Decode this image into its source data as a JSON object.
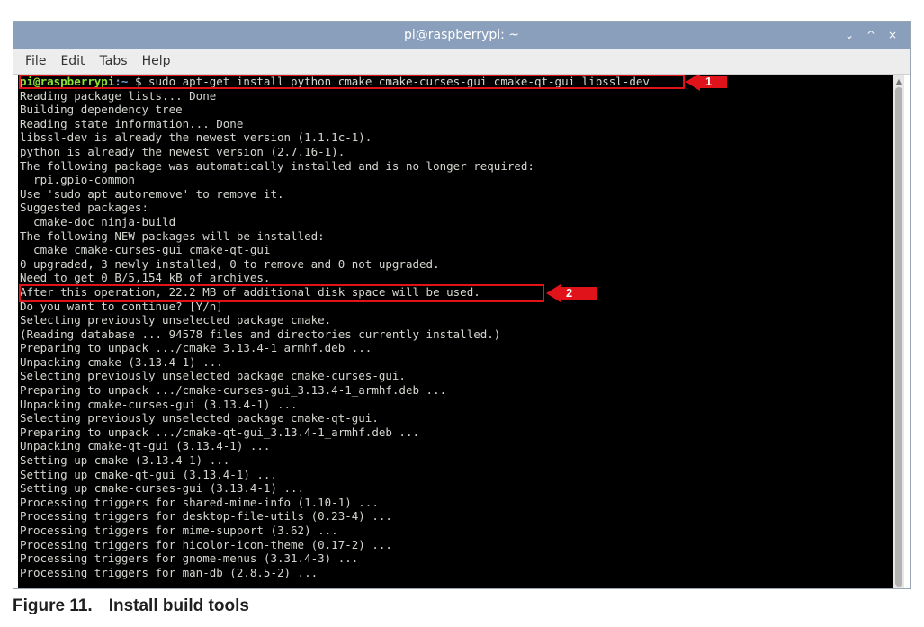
{
  "window": {
    "title": "pi@raspberrypi: ~",
    "controls": [
      "⌄",
      "^",
      "×"
    ]
  },
  "menubar": {
    "items": [
      "File",
      "Edit",
      "Tabs",
      "Help"
    ]
  },
  "terminal": {
    "prompt_user": "pi@raspberrypi",
    "prompt_path": ":~",
    "prompt_symbol": " $ ",
    "command": "sudo apt-get install python cmake cmake-curses-gui cmake-qt-gui libssl-dev",
    "output": [
      "Reading package lists... Done",
      "Building dependency tree",
      "Reading state information... Done",
      "libssl-dev is already the newest version (1.1.1c-1).",
      "python is already the newest version (2.7.16-1).",
      "The following package was automatically installed and is no longer required:",
      "  rpi.gpio-common",
      "Use 'sudo apt autoremove' to remove it.",
      "Suggested packages:",
      "  cmake-doc ninja-build",
      "The following NEW packages will be installed:",
      "  cmake cmake-curses-gui cmake-qt-gui",
      "0 upgraded, 3 newly installed, 0 to remove and 0 not upgraded.",
      "Need to get 0 B/5,154 kB of archives.",
      "After this operation, 22.2 MB of additional disk space will be used.",
      "Do you want to continue? [Y/n]",
      "Selecting previously unselected package cmake.",
      "(Reading database ... 94578 files and directories currently installed.)",
      "Preparing to unpack .../cmake_3.13.4-1_armhf.deb ...",
      "Unpacking cmake (3.13.4-1) ...",
      "Selecting previously unselected package cmake-curses-gui.",
      "Preparing to unpack .../cmake-curses-gui_3.13.4-1_armhf.deb ...",
      "Unpacking cmake-curses-gui (3.13.4-1) ...",
      "Selecting previously unselected package cmake-qt-gui.",
      "Preparing to unpack .../cmake-qt-gui_3.13.4-1_armhf.deb ...",
      "Unpacking cmake-qt-gui (3.13.4-1) ...",
      "Setting up cmake (3.13.4-1) ...",
      "Setting up cmake-qt-gui (3.13.4-1) ...",
      "Setting up cmake-curses-gui (3.13.4-1) ...",
      "Processing triggers for shared-mime-info (1.10-1) ...",
      "Processing triggers for desktop-file-utils (0.23-4) ...",
      "Processing triggers for mime-support (3.62) ...",
      "Processing triggers for hicolor-icon-theme (0.17-2) ...",
      "Processing triggers for gnome-menus (3.31.4-3) ...",
      "Processing triggers for man-db (2.8.5-2) ..."
    ]
  },
  "callouts": [
    "1",
    "2"
  ],
  "caption": {
    "number": "Figure 11.",
    "text": "Install build tools"
  },
  "colors": {
    "titlebar": "#8a9fbc",
    "terminal_bg": "#000000",
    "terminal_fg": "#d3d7cf",
    "prompt_user": "#8ae234",
    "prompt_path": "#729fcf",
    "highlight": "#e0131b"
  }
}
